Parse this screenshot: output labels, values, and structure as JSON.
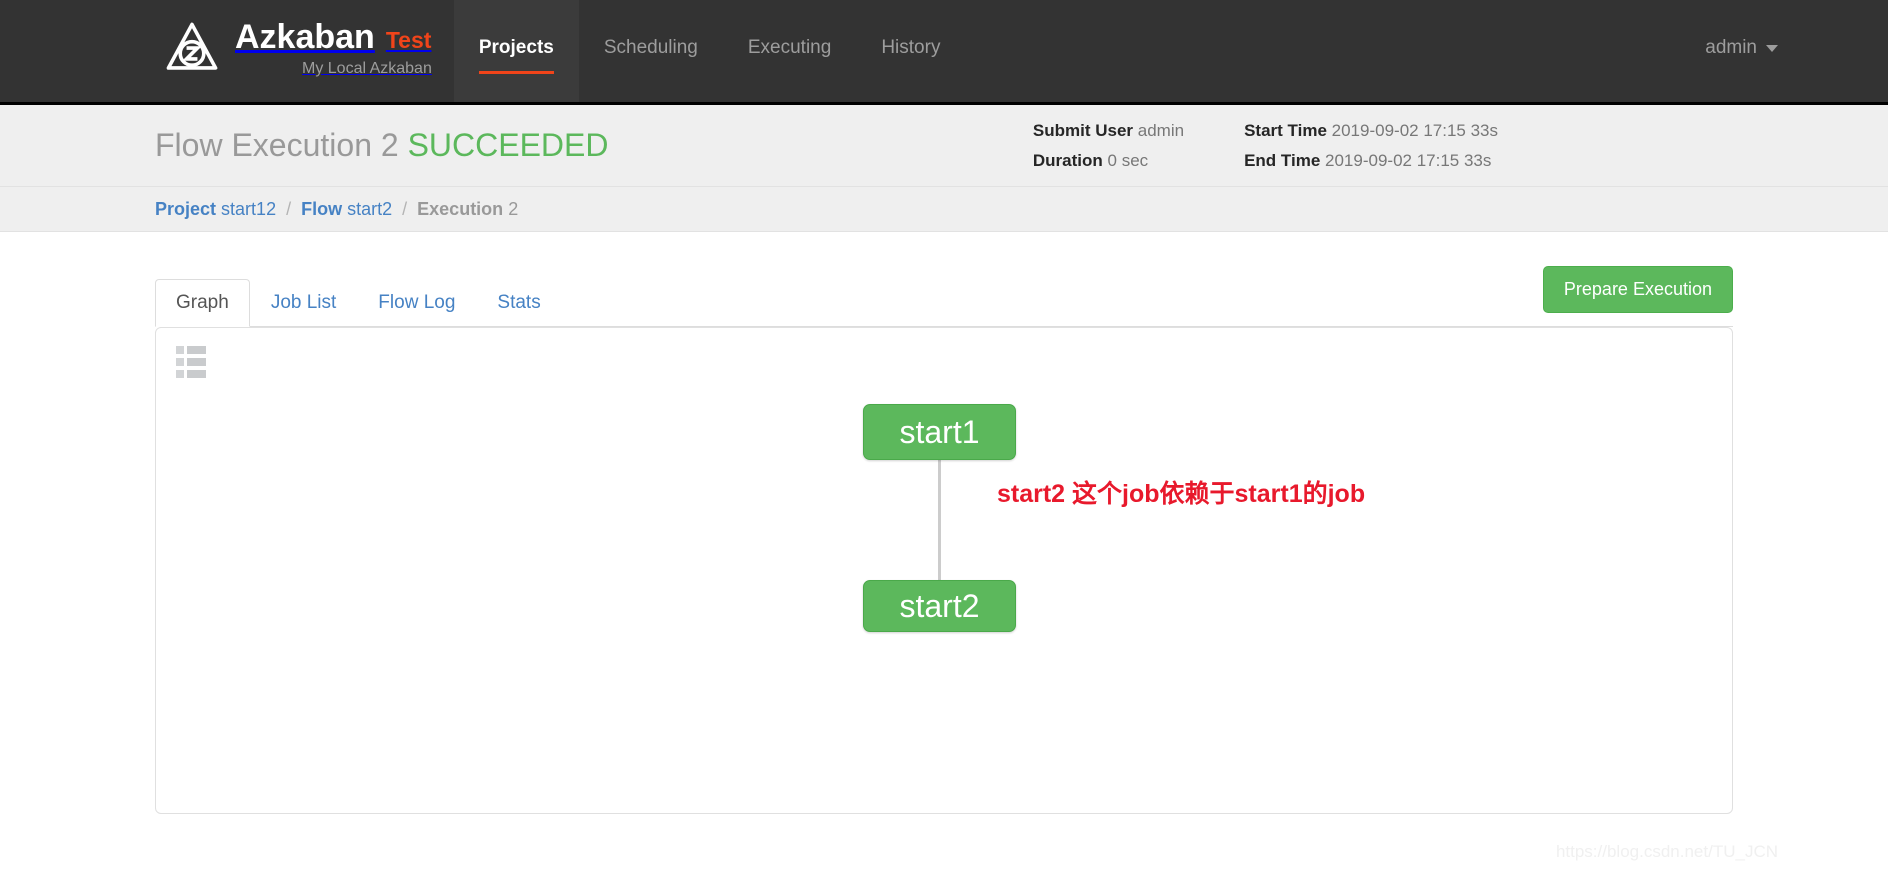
{
  "navbar": {
    "brand_name": "Azkaban",
    "brand_tag": "Test",
    "brand_sub": "My Local Azkaban",
    "logo_icon": "azkaban-logo-icon",
    "items": [
      {
        "label": "Projects",
        "active": true
      },
      {
        "label": "Scheduling",
        "active": false
      },
      {
        "label": "Executing",
        "active": false
      },
      {
        "label": "History",
        "active": false
      }
    ],
    "user": "admin",
    "caret_icon": "chevron-down-icon"
  },
  "exec_header": {
    "title_prefix": "Flow Execution 2",
    "status": "SUCCEEDED",
    "meta": [
      {
        "label": "Submit User",
        "value": "admin"
      },
      {
        "label": "Duration",
        "value": "0 sec"
      },
      {
        "label": "Start Time",
        "value": "2019-09-02 17:15 33s"
      },
      {
        "label": "End Time",
        "value": "2019-09-02 17:15 33s"
      }
    ]
  },
  "breadcrumb": {
    "project_label": "Project",
    "project_value": "start12",
    "flow_label": "Flow",
    "flow_value": "start2",
    "execution_label": "Execution",
    "execution_value": "2",
    "separator": "/"
  },
  "tabs": [
    {
      "label": "Graph",
      "active": true
    },
    {
      "label": "Job List",
      "active": false
    },
    {
      "label": "Flow Log",
      "active": false
    },
    {
      "label": "Stats",
      "active": false
    }
  ],
  "actions": {
    "prepare_execution": "Prepare Execution"
  },
  "graph": {
    "menu_icon": "list-grid-icon",
    "nodes": [
      {
        "id": "start1",
        "label": "start1"
      },
      {
        "id": "start2",
        "label": "start2"
      }
    ],
    "annotation": "start2 这个job依赖于start1的job",
    "colors": {
      "node_green": "#5cb85c",
      "annotation_red": "#e8192c",
      "edge_gray": "#cccccc"
    }
  },
  "watermark": "https://blog.csdn.net/TU_JCN"
}
